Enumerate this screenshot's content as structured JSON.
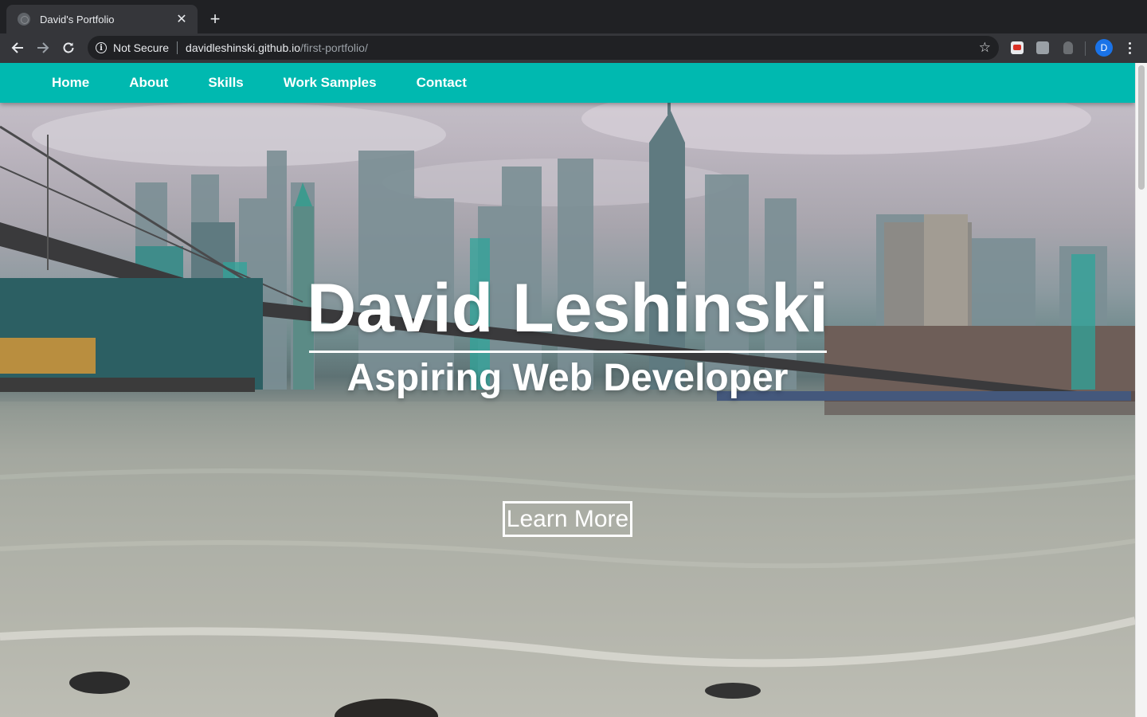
{
  "browser": {
    "tab": {
      "title": "David's Portfolio",
      "favicon": "globe-icon"
    },
    "address": {
      "security_label": "Not Secure",
      "host": "davidleshinski.github.io",
      "path": "/first-portfolio/"
    },
    "avatar_initial": "D"
  },
  "site": {
    "nav": {
      "items": [
        {
          "label": "Home"
        },
        {
          "label": "About"
        },
        {
          "label": "Skills"
        },
        {
          "label": "Work Samples"
        },
        {
          "label": "Contact"
        }
      ],
      "color": "#00b9b0"
    },
    "hero": {
      "title": "David Leshinski",
      "subtitle": "Aspiring Web Developer",
      "cta_label": "Learn More",
      "background": "city-skyline-waterfront-photo"
    }
  }
}
